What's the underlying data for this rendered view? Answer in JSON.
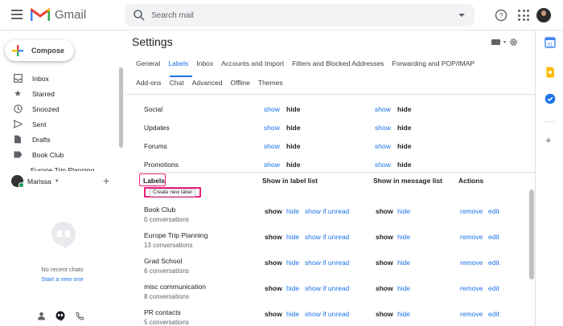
{
  "app": {
    "name": "Gmail"
  },
  "search": {
    "placeholder": "Search mail"
  },
  "colors": {
    "accent": "#1a73e8",
    "highlight": "#e91e7a",
    "gmail_red": "#ea4335"
  },
  "compose": {
    "label": "Compose"
  },
  "nav": [
    {
      "label": "Inbox",
      "icon": "inbox-icon"
    },
    {
      "label": "Starred",
      "icon": "star-icon"
    },
    {
      "label": "Snoozed",
      "icon": "clock-icon"
    },
    {
      "label": "Sent",
      "icon": "send-icon"
    },
    {
      "label": "Drafts",
      "icon": "draft-icon"
    },
    {
      "label": "Book Club",
      "icon": "label-icon"
    }
  ],
  "nav_partial": "Europe Trip Planning",
  "hangouts": {
    "user": "Marissa",
    "no_chats": "No recent chats",
    "start_new": "Start a new one"
  },
  "settings": {
    "title": "Settings",
    "tabs_row1": [
      "General",
      "Labels",
      "Inbox",
      "Accounts and Import",
      "Filters and Blocked Addresses",
      "Forwarding and POP/IMAP"
    ],
    "tabs_row2": [
      "Add-ons",
      "Chat",
      "Advanced",
      "Offline",
      "Themes"
    ],
    "active_tab": "Labels"
  },
  "system_rows": [
    {
      "name": "Social",
      "a1": "show",
      "a2": "hide",
      "b1": "show",
      "b2": "hide"
    },
    {
      "name": "Updates",
      "a1": "show",
      "a2": "hide",
      "b1": "show",
      "b2": "hide"
    },
    {
      "name": "Forums",
      "a1": "show",
      "a2": "hide",
      "b1": "show",
      "b2": "hide"
    },
    {
      "name": "Promotions",
      "a1": "show",
      "a2": "hide",
      "b1": "show",
      "b2": "hide"
    }
  ],
  "labels_section": {
    "heading": "Labels",
    "col_show_in_label_list": "Show in label list",
    "col_show_in_message_list": "Show in message list",
    "col_actions": "Actions",
    "create_button": "Create new label"
  },
  "user_labels": [
    {
      "name": "Book Club",
      "count": "0 conversations",
      "show": "show",
      "hide": "hide",
      "unread": "show if unread",
      "mshow": "show",
      "mhide": "hide",
      "remove": "remove",
      "edit": "edit"
    },
    {
      "name": "Europe Trip Planning",
      "count": "13 conversations",
      "show": "show",
      "hide": "hide",
      "unread": "show if unread",
      "mshow": "show",
      "mhide": "hide",
      "remove": "remove",
      "edit": "edit"
    },
    {
      "name": "Grad School",
      "count": "6 conversations",
      "show": "show",
      "hide": "hide",
      "unread": "show if unread",
      "mshow": "show",
      "mhide": "hide",
      "remove": "remove",
      "edit": "edit"
    },
    {
      "name": "misc communication",
      "count": "8 conversations",
      "show": "show",
      "hide": "hide",
      "unread": "show if unread",
      "mshow": "show",
      "mhide": "hide",
      "remove": "remove",
      "edit": "edit"
    },
    {
      "name": "PR contacts",
      "count": "5 conversations",
      "show": "show",
      "hide": "hide",
      "unread": "show if unread",
      "mshow": "show",
      "mhide": "hide",
      "remove": "remove",
      "edit": "edit"
    }
  ],
  "rail_icons": [
    "calendar-icon",
    "keep-icon",
    "tasks-icon",
    "add-icon"
  ]
}
